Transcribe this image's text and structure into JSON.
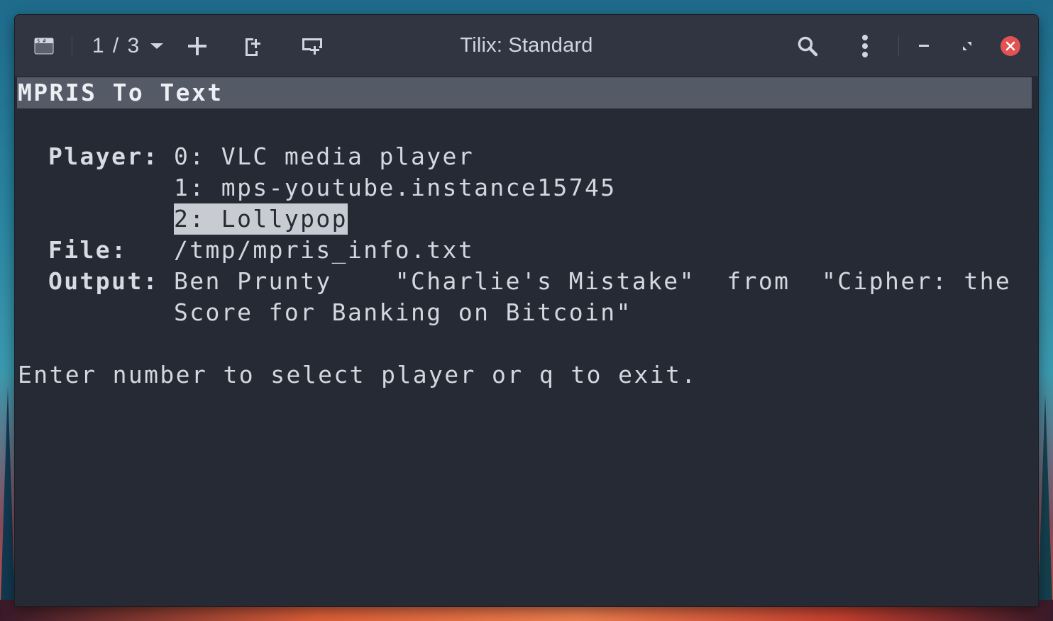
{
  "window": {
    "title": "Tilix: Standard",
    "session_counter": "1 / 3"
  },
  "icons": {
    "terminal": "terminal-icon",
    "dropdown": "chevron-down-icon",
    "add": "plus-icon",
    "add_right": "add-terminal-right-icon",
    "add_down": "add-terminal-down-icon",
    "search": "search-icon",
    "menu": "kebab-menu-icon",
    "minimize": "minimize-icon",
    "maximize": "maximize-icon",
    "close": "close-icon"
  },
  "colors": {
    "close": "#e25252",
    "terminal_bg": "#262a35",
    "headerbar_bg": "#303541"
  },
  "terminal": {
    "app_title": "MPRIS To Text",
    "player_label": "Player:",
    "players": [
      "0: VLC media player",
      "1: mps-youtube.instance15745",
      "2: Lollypop"
    ],
    "file_label": "File:",
    "file_value": "/tmp/mpris_info.txt",
    "output_label": "Output:",
    "output_line1": "Ben Prunty    \"Charlie's Mistake\"  from  \"Cipher: the",
    "output_line2": "Score for Banking on Bitcoin\"",
    "prompt": "Enter number to select player or q to exit."
  }
}
